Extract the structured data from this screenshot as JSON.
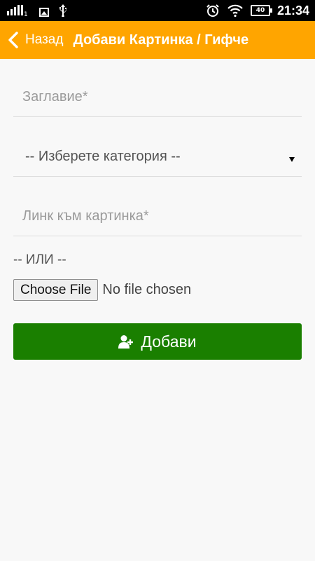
{
  "status_bar": {
    "sim_slot": "1",
    "battery_level": "40",
    "time": "21:34",
    "icons": [
      "signal-icon",
      "image-icon",
      "usb-icon",
      "alarm-icon",
      "wifi-icon",
      "battery-icon"
    ]
  },
  "app_bar": {
    "back_label": "Назад",
    "title": "Добави Картинка / Гифче",
    "background_color": "#ffa500"
  },
  "form": {
    "title_placeholder": "Заглавие*",
    "category_selected": "-- Изберете категория --",
    "link_placeholder": "Линк към картинка*",
    "or_label": "-- ИЛИ --",
    "choose_file_label": "Choose File",
    "no_file_label": "No file chosen",
    "submit_label": "Добави",
    "submit_color": "#1a7f00"
  }
}
